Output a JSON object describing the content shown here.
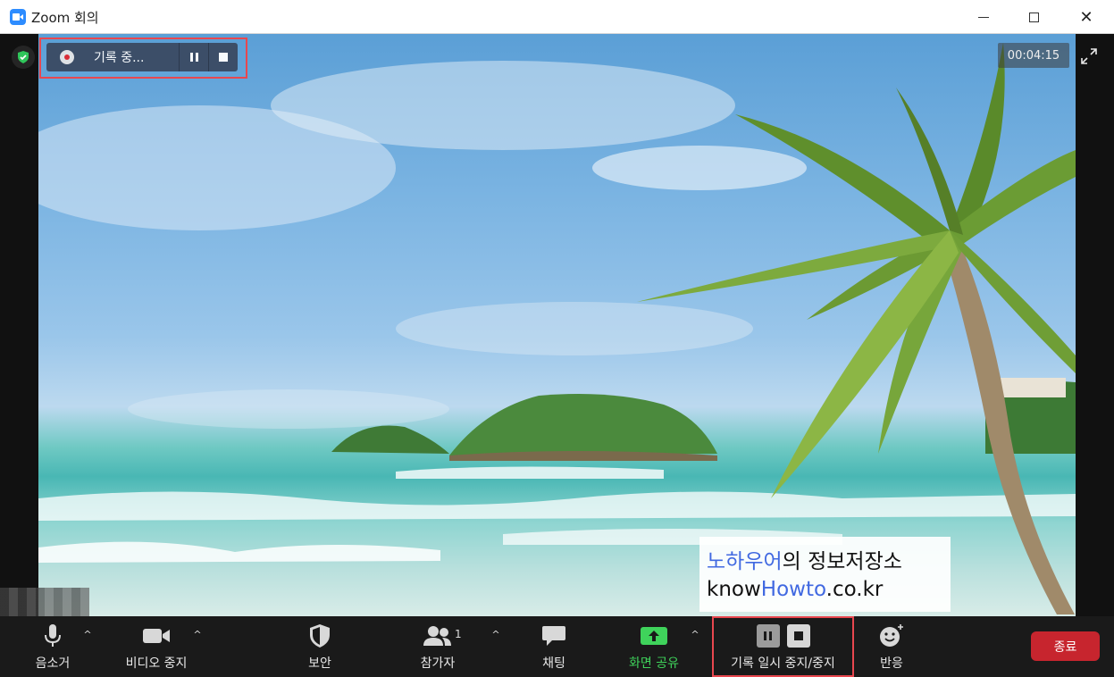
{
  "window": {
    "title": "Zoom 회의",
    "close_glyph": "✕"
  },
  "recording": {
    "status": "기록 중...",
    "timer": "00:04:15"
  },
  "watermark": {
    "line1_blue": "노하우어",
    "line1_rest": "의 정보저장소",
    "line2_pre": "know",
    "line2_blue": "Howto",
    "line2_post": ".co.kr"
  },
  "toolbar": {
    "mute_label": "음소거",
    "video_label": "비디오 중지",
    "security_label": "보안",
    "participants_label": "참가자",
    "participants_count": "1",
    "chat_label": "채팅",
    "share_label": "화면 공유",
    "record_label": "기록 일시 중지/중지",
    "reactions_label": "반응",
    "end_label": "종료",
    "caret": "^"
  },
  "colors": {
    "accent": "#2d8cff",
    "end_red": "#c7252e",
    "share_green": "#3fd35b",
    "record_red": "#e0262e"
  }
}
